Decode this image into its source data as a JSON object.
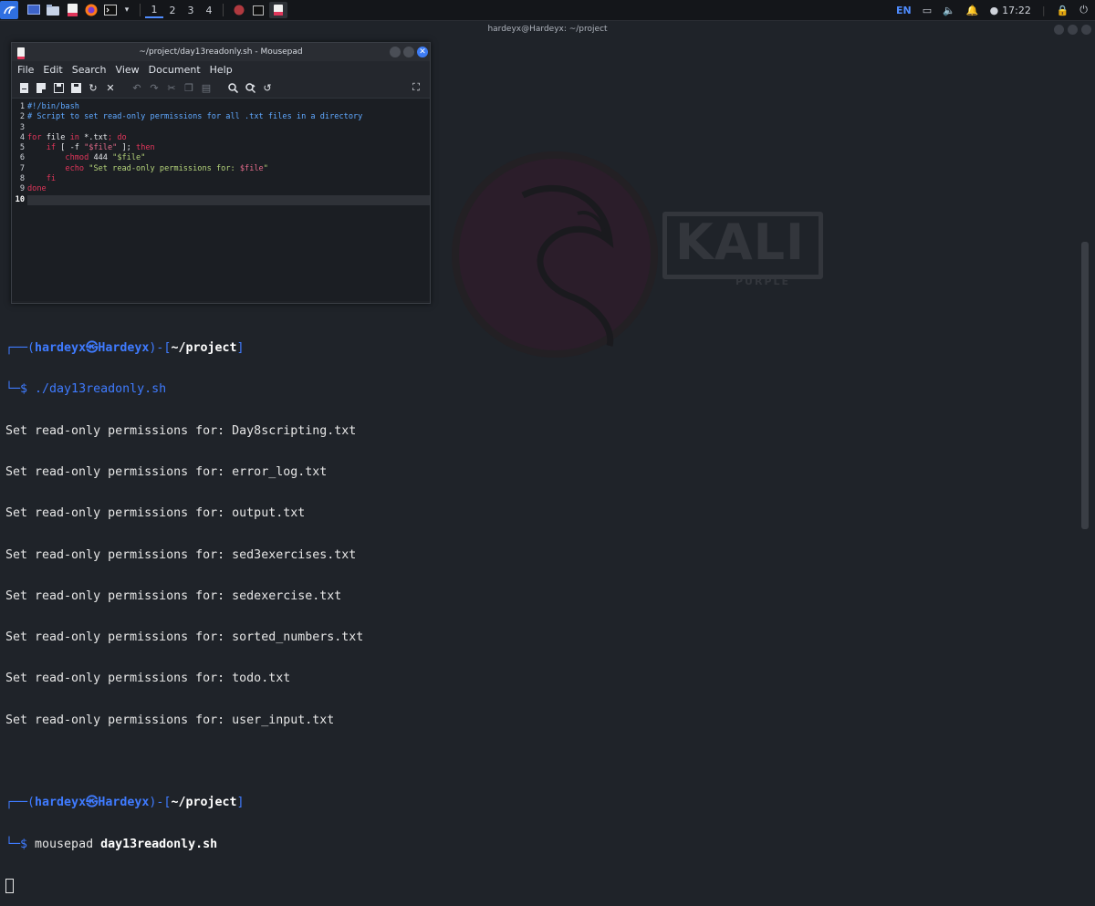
{
  "taskbar": {
    "workspaces": [
      "1",
      "2",
      "3",
      "4"
    ],
    "active_workspace": "1",
    "language": "EN",
    "clock": "17:22"
  },
  "terminal": {
    "title": "hardeyx@Hardeyx: ~/project",
    "prompt1": {
      "open": "┌──(",
      "user": "hardeyx",
      "at": "㉿",
      "host": "Hardeyx",
      "mid": ")-[",
      "path": "~/project",
      "close": "]",
      "prefix": "└─$ ",
      "command": "./day13readonly.sh"
    },
    "output": [
      "Set read-only permissions for: Day8scripting.txt",
      "Set read-only permissions for: error_log.txt",
      "Set read-only permissions for: output.txt",
      "Set read-only permissions for: sed3exercises.txt",
      "Set read-only permissions for: sedexercise.txt",
      "Set read-only permissions for: sorted_numbers.txt",
      "Set read-only permissions for: todo.txt",
      "Set read-only permissions for: user_input.txt"
    ],
    "prompt2": {
      "open": "┌──(",
      "user": "hardeyx",
      "at": "㉿",
      "host": "Hardeyx",
      "mid": ")-[",
      "path": "~/project",
      "close": "]",
      "prefix": "└─$ ",
      "cmd_word": "mousepad",
      "cmd_arg": "day13readonly.sh"
    }
  },
  "wallpaper": {
    "brand": "KALI",
    "edition": "PURPLE"
  },
  "mousepad": {
    "title": "~/project/day13readonly.sh - Mousepad",
    "menu": [
      "File",
      "Edit",
      "Search",
      "View",
      "Document",
      "Help"
    ],
    "line_numbers": [
      "1",
      "2",
      "3",
      "4",
      "5",
      "6",
      "7",
      "8",
      "9",
      "10"
    ],
    "current_line": 10,
    "code": {
      "l1": "#!/bin/bash",
      "l2": "# Script to set read-only permissions for all .txt files in a directory",
      "l4_for": "for",
      "l4_file": " file ",
      "l4_in": "in",
      "l4_glob": " *.txt",
      "l4_semi": "; ",
      "l4_do": "do",
      "l5_indent": "    ",
      "l5_if": "if",
      "l5_open": " [ -f ",
      "l5_str": "\"$file\"",
      "l5_close": " ]; ",
      "l5_then": "then",
      "l6_indent": "        ",
      "l6_cmd": "chmod",
      "l6_num": " 444 ",
      "l6_str": "\"$file\"",
      "l7_indent": "        ",
      "l7_cmd": "echo",
      "l7_str": " \"Set read-only permissions for: ",
      "l7_var": "$file",
      "l7_end": "\"",
      "l8_indent": "    ",
      "l8_fi": "fi",
      "l9_done": "done"
    }
  },
  "colors": {
    "accent_blue": "#3f7bff",
    "keyword_red": "#e0355a",
    "string_green": "#b4d37a",
    "comment_blue": "#5fa8ff"
  }
}
